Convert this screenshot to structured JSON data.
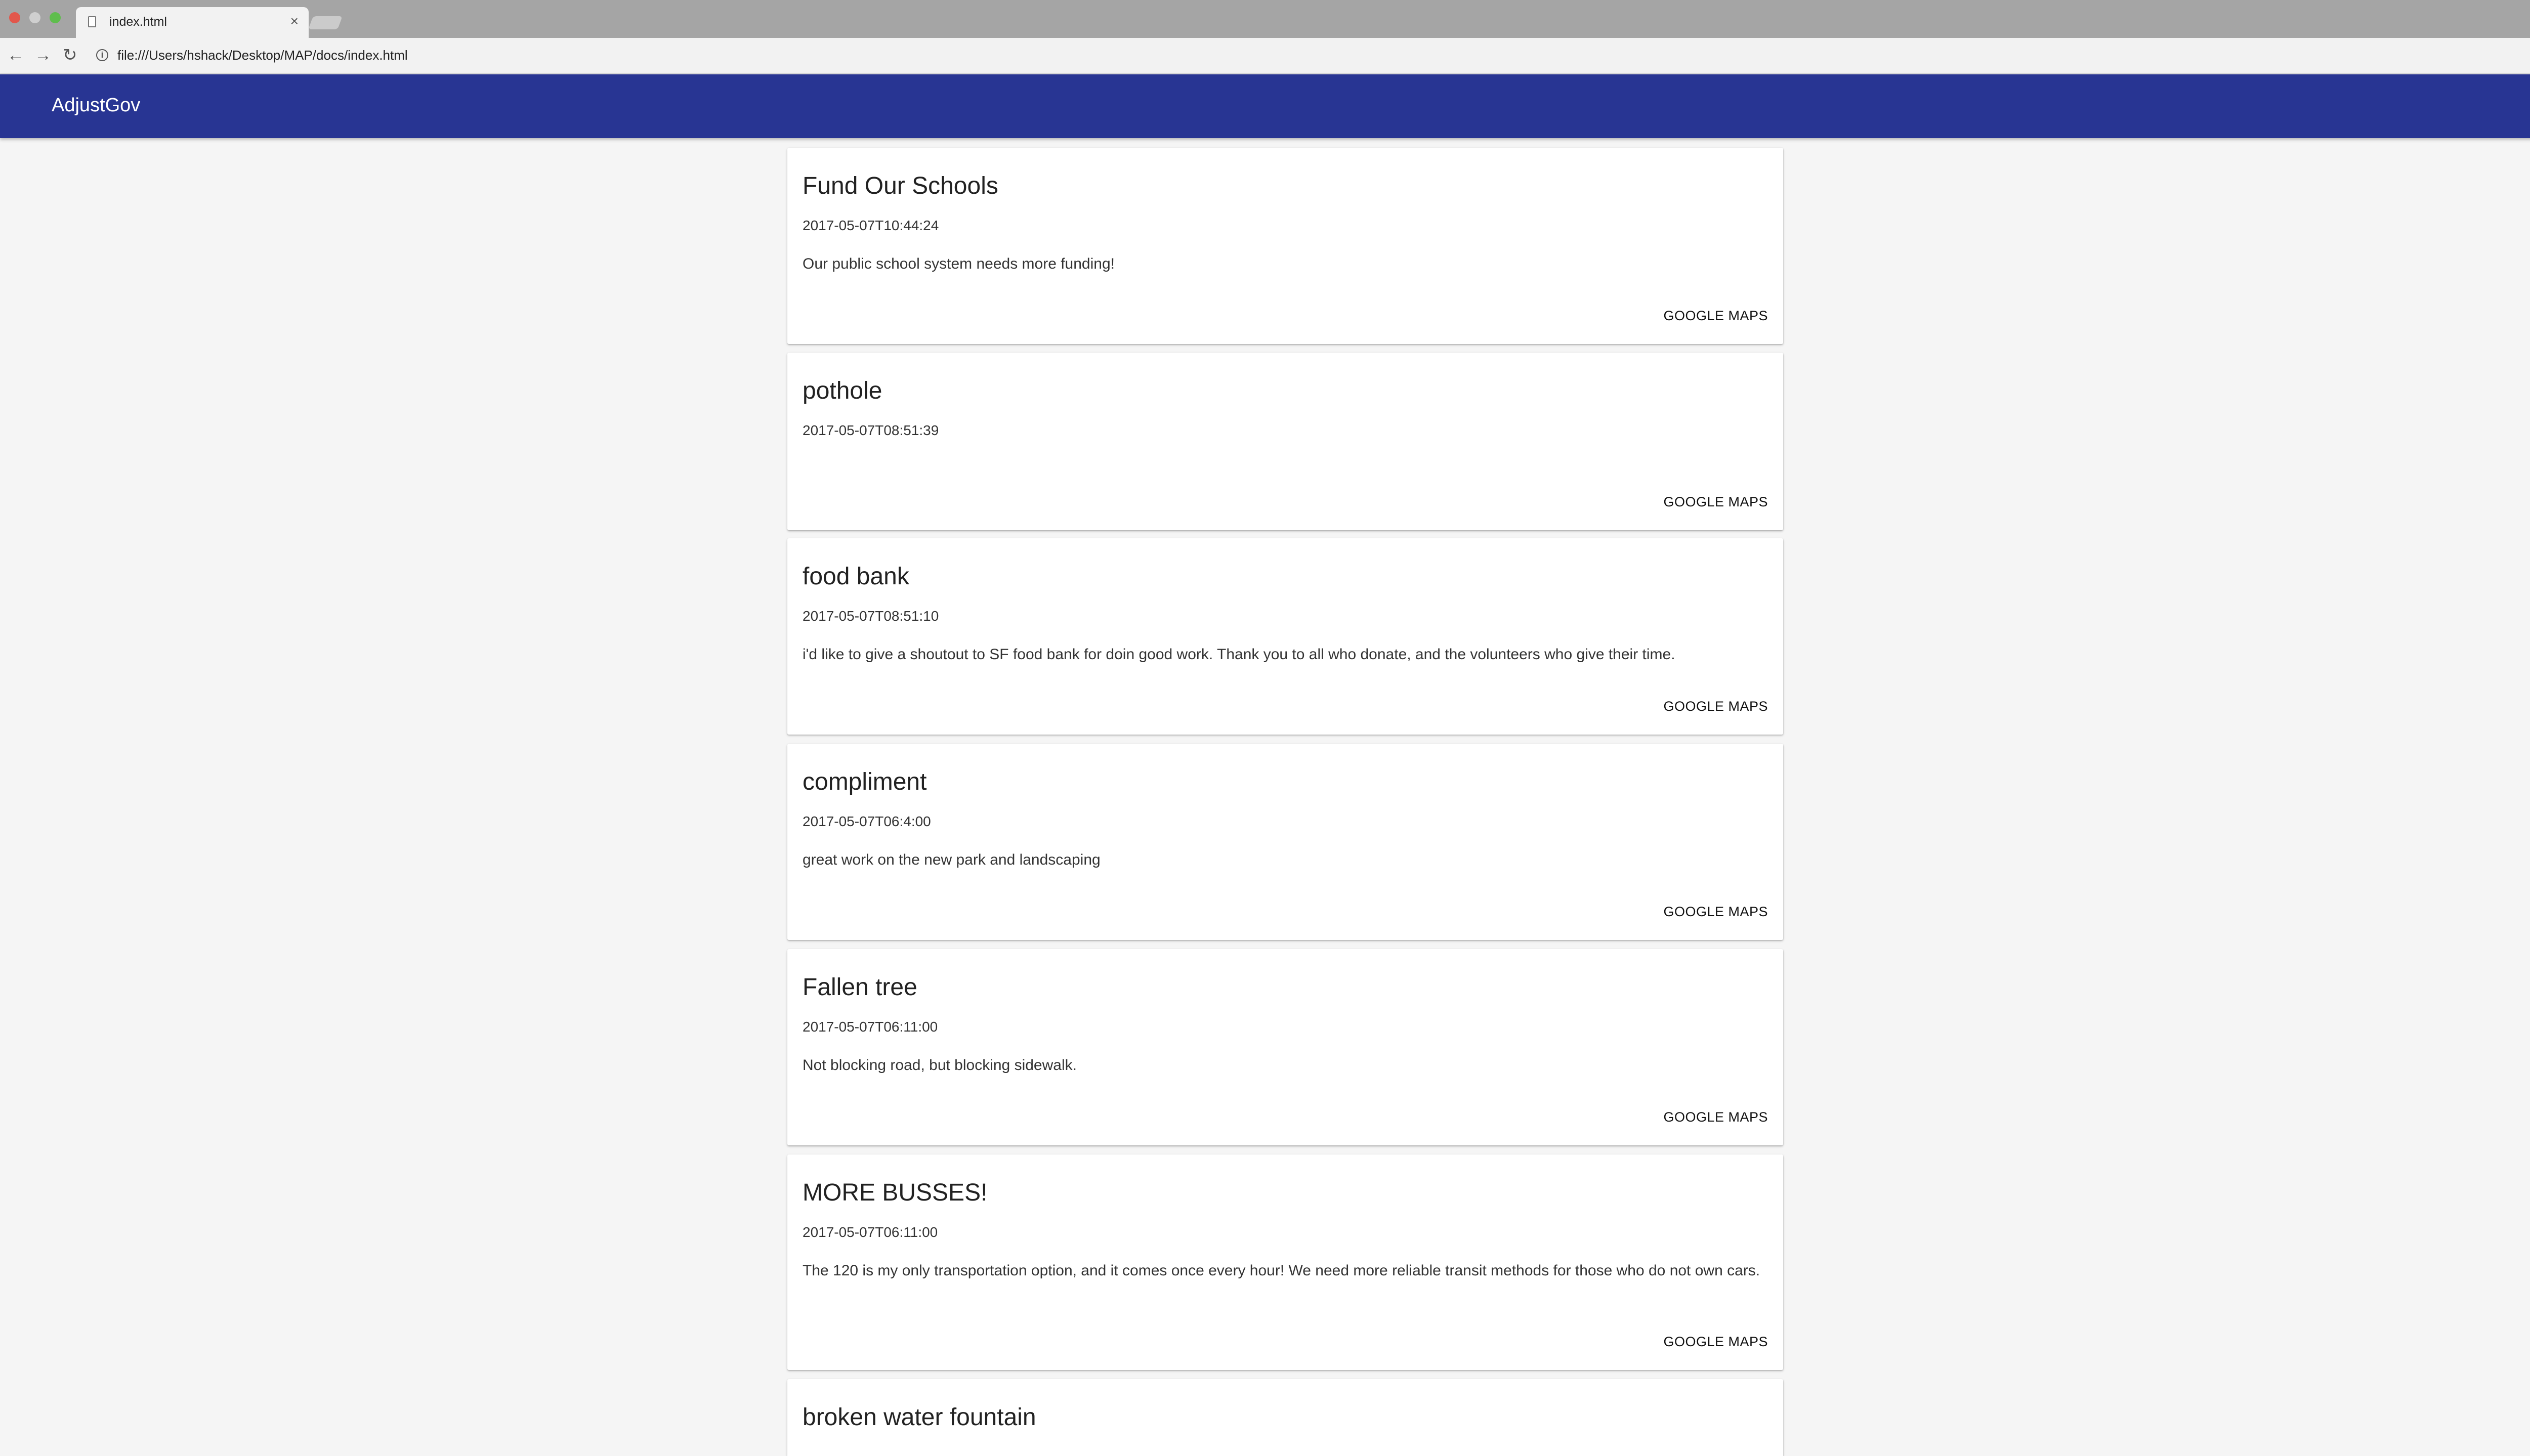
{
  "browser": {
    "tab_title": "index.html",
    "tab_close": "×",
    "url": "file:///Users/hshack/Desktop/MAP/docs/index.html"
  },
  "app": {
    "brand": "AdjustGov"
  },
  "posts": [
    {
      "title": "Fund Our Schools",
      "date": "2017-05-07T10:44:24",
      "body": "Our public school system needs more funding!",
      "action": "GOOGLE MAPS"
    },
    {
      "title": "pothole",
      "date": "2017-05-07T08:51:39",
      "body": "",
      "action": "GOOGLE MAPS"
    },
    {
      "title": "food bank",
      "date": "2017-05-07T08:51:10",
      "body": "i'd like to give a shoutout to SF food bank for doin good work. Thank you to all who donate, and the volunteers who give their time.",
      "action": "GOOGLE MAPS"
    },
    {
      "title": "compliment",
      "date": "2017-05-07T06:4:00",
      "body": "great work on the new park and landscaping",
      "action": "GOOGLE MAPS"
    },
    {
      "title": "Fallen tree",
      "date": "2017-05-07T06:11:00",
      "body": "Not blocking road, but blocking sidewalk.",
      "action": "GOOGLE MAPS"
    },
    {
      "title": "MORE BUSSES!",
      "date": "2017-05-07T06:11:00",
      "body": "The 120 is my only transportation option, and it comes once every hour! We need more reliable transit methods for those who do not own cars.",
      "action": "GOOGLE MAPS"
    },
    {
      "title": "broken water fountain",
      "date": "",
      "body": "",
      "action": ""
    }
  ],
  "colors": {
    "appbar": "#283593",
    "page_bg": "#f5f5f5"
  }
}
